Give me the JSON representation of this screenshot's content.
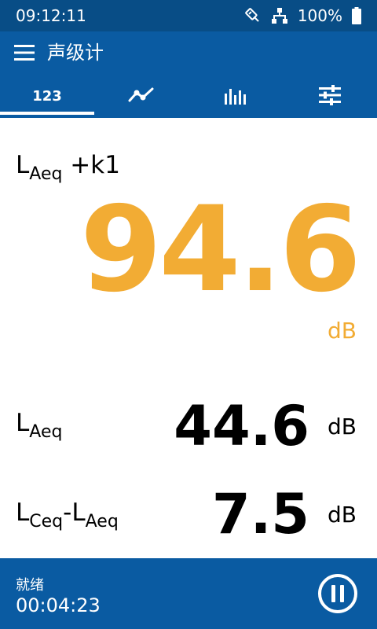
{
  "status_bar": {
    "time": "09:12:11",
    "battery": "100%"
  },
  "app_bar": {
    "title": "声级计",
    "tabs": [
      {
        "label": "123",
        "icon": "numeric-display",
        "active": true
      },
      {
        "label": "",
        "icon": "trend-chart-icon",
        "active": false
      },
      {
        "label": "",
        "icon": "spectrum-bars-icon",
        "active": false
      },
      {
        "label": "",
        "icon": "sliders-icon",
        "active": false
      }
    ]
  },
  "main": {
    "label_base": "L",
    "label_sub": "Aeq",
    "label_suffix": " +k1",
    "value": "94.6",
    "unit": "dB"
  },
  "rows": [
    {
      "label_base": "L",
      "label_sub": "Aeq",
      "value": "44.6",
      "unit": "dB"
    },
    {
      "label_base": "L",
      "label_sub": "Ceq",
      "label_sep": "-L",
      "label_sub2": "Aeq",
      "value": "7.5",
      "unit": "dB"
    }
  ],
  "footer": {
    "status": "就绪",
    "elapsed": "00:04:23"
  },
  "colors": {
    "primary": "#0a5ba2",
    "status_bar": "#084d86",
    "accent": "#f2ac34"
  }
}
